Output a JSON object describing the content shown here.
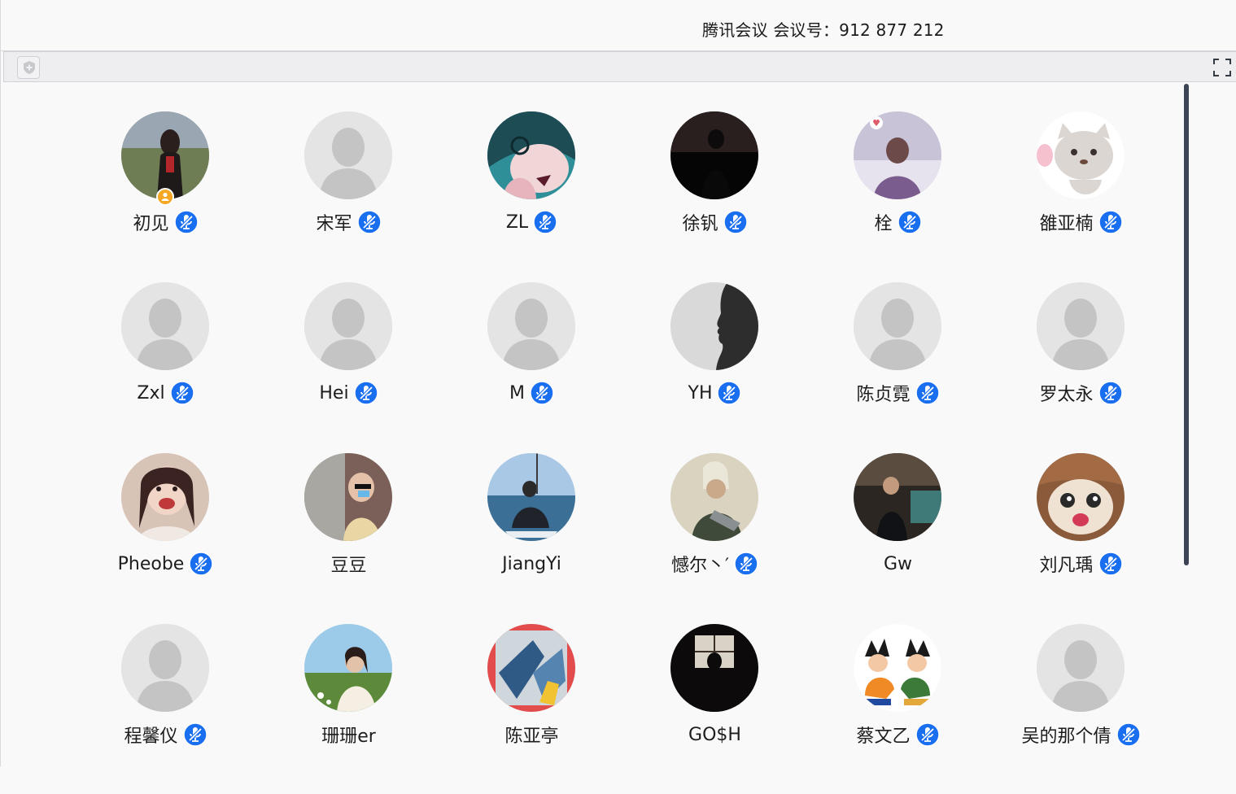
{
  "window": {
    "title": "腾讯会议 会议号：912 877 212"
  },
  "toolbar": {
    "security_icon": "shield-icon",
    "fullscreen_icon": "fullscreen-icon"
  },
  "colors": {
    "mic_blue": "#1a6ef0",
    "mic_muted_stroke": "#ffffff",
    "host_badge": "#f5a623",
    "scrollbar": "#3d4456",
    "default_avatar_bg": "#e4e4e4",
    "default_avatar_fg": "#c4c4c4"
  },
  "participants": [
    {
      "name": "初见",
      "muted": true,
      "host": true,
      "avatar": "photo-girl-grassland"
    },
    {
      "name": "宋军",
      "muted": true,
      "host": false,
      "avatar": "default"
    },
    {
      "name": "ZL",
      "muted": true,
      "host": false,
      "avatar": "anime-boy"
    },
    {
      "name": "徐钒",
      "muted": true,
      "host": false,
      "avatar": "dark-silhouette"
    },
    {
      "name": "栓",
      "muted": true,
      "host": false,
      "avatar": "photo-person-purple"
    },
    {
      "name": "雒亚楠",
      "muted": true,
      "host": false,
      "avatar": "cartoon-cat"
    },
    {
      "name": "Zxl",
      "muted": true,
      "host": false,
      "avatar": "default"
    },
    {
      "name": "Hei",
      "muted": true,
      "host": false,
      "avatar": "default"
    },
    {
      "name": "M",
      "muted": true,
      "host": false,
      "avatar": "default"
    },
    {
      "name": "YH",
      "muted": true,
      "host": false,
      "avatar": "shadow-profile"
    },
    {
      "name": "陈贞霓",
      "muted": true,
      "host": false,
      "avatar": "default"
    },
    {
      "name": "罗太永",
      "muted": true,
      "host": false,
      "avatar": "default"
    },
    {
      "name": "Pheobe",
      "muted": true,
      "host": false,
      "avatar": "photo-girl-smile"
    },
    {
      "name": "豆豆",
      "muted": false,
      "host": false,
      "avatar": "photo-child"
    },
    {
      "name": "JiangYi",
      "muted": false,
      "host": false,
      "avatar": "photo-sea"
    },
    {
      "name": "憾尔丶′",
      "muted": true,
      "host": false,
      "avatar": "game-character"
    },
    {
      "name": "Gw",
      "muted": false,
      "host": false,
      "avatar": "photo-street"
    },
    {
      "name": "刘凡瑀",
      "muted": true,
      "host": false,
      "avatar": "cat-hat"
    },
    {
      "name": "程馨仪",
      "muted": true,
      "host": false,
      "avatar": "default"
    },
    {
      "name": "珊珊er",
      "muted": false,
      "host": false,
      "avatar": "photo-girl-field"
    },
    {
      "name": "陈亚亭",
      "muted": false,
      "host": false,
      "avatar": "art-poster"
    },
    {
      "name": "GO$H",
      "muted": false,
      "host": false,
      "avatar": "dark-window"
    },
    {
      "name": "蔡文乙",
      "muted": true,
      "host": false,
      "avatar": "cartoon-fighters"
    },
    {
      "name": "吴的那个倩",
      "muted": true,
      "host": false,
      "avatar": "default"
    }
  ]
}
